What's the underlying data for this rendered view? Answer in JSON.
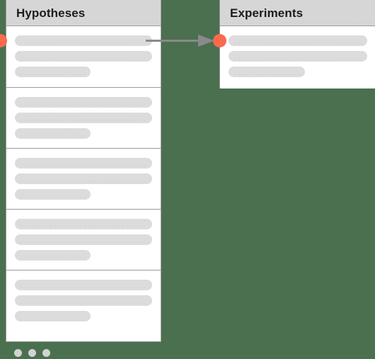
{
  "board": {
    "background_color": "#4a7050",
    "accent_color": "#fa6a4f",
    "connector_color": "#8a8a8a",
    "placeholder_color": "#dcdcdc",
    "header_color": "#d6d6d6"
  },
  "columns": [
    {
      "id": "hypotheses",
      "title": "Hypotheses",
      "cards": [
        {
          "lines": [
            "full",
            "full",
            "short"
          ]
        },
        {
          "lines": [
            "full",
            "full",
            "short"
          ]
        },
        {
          "lines": [
            "full",
            "full",
            "short"
          ]
        },
        {
          "lines": [
            "full",
            "full",
            "short"
          ]
        },
        {
          "lines": [
            "full",
            "full",
            "short"
          ]
        }
      ]
    },
    {
      "id": "experiments",
      "title": "Experiments",
      "cards": [
        {
          "lines": [
            "full",
            "full",
            "short"
          ]
        }
      ]
    }
  ],
  "connector": {
    "from": "hypotheses-card-1",
    "to": "experiments-card-1",
    "label": ""
  },
  "pagination": {
    "dot_count": 3,
    "active_index": 0
  }
}
